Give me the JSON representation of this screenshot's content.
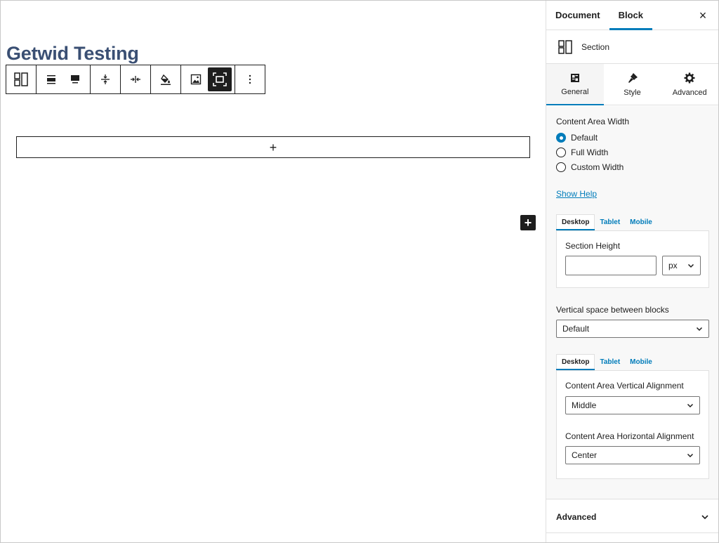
{
  "page": {
    "title": "Getwid Testing"
  },
  "colors": {
    "accent": "#007cba",
    "title": "#3a4f73",
    "dark": "#1e1e1e"
  },
  "toolbar": {
    "buttons": [
      {
        "name": "section-block-type-button",
        "icon": "section-icon"
      },
      {
        "name": "align-top-button",
        "icon": "align-center-icon"
      },
      {
        "name": "align-wide-button",
        "icon": "align-wide-icon"
      },
      {
        "name": "vertical-spacing-button",
        "icon": "vertical-spacing-icon"
      },
      {
        "name": "horizontal-spacing-button",
        "icon": "horizontal-spacing-icon"
      },
      {
        "name": "background-color-button",
        "icon": "paint-bucket-icon"
      },
      {
        "name": "background-image-button",
        "icon": "image-icon"
      },
      {
        "name": "fullscreen-width-button",
        "icon": "fullscreen-icon"
      },
      {
        "name": "more-options-button",
        "icon": "vertical-ellipsis-icon"
      }
    ],
    "appender_symbol": "+",
    "inserter_symbol": "+"
  },
  "sidebar": {
    "tabs": [
      {
        "label": "Document"
      },
      {
        "label": "Block"
      }
    ],
    "close_symbol": "×",
    "block": {
      "name": "Section"
    },
    "inner_tabs": [
      {
        "label": "General"
      },
      {
        "label": "Style"
      },
      {
        "label": "Advanced"
      }
    ],
    "content_area_width": {
      "label": "Content Area Width",
      "options": [
        "Default",
        "Full Width",
        "Custom Width"
      ],
      "selected": "Default"
    },
    "show_help": "Show Help",
    "responsive_tabs": [
      "Desktop",
      "Tablet",
      "Mobile"
    ],
    "section_height": {
      "label": "Section Height",
      "value": "",
      "unit": "px"
    },
    "vertical_space": {
      "label": "Vertical space between blocks",
      "value": "Default"
    },
    "vertical_alignment": {
      "label": "Content Area Vertical Alignment",
      "value": "Middle"
    },
    "horizontal_alignment": {
      "label": "Content Area Horizontal Alignment",
      "value": "Center"
    },
    "advanced": {
      "label": "Advanced"
    }
  }
}
